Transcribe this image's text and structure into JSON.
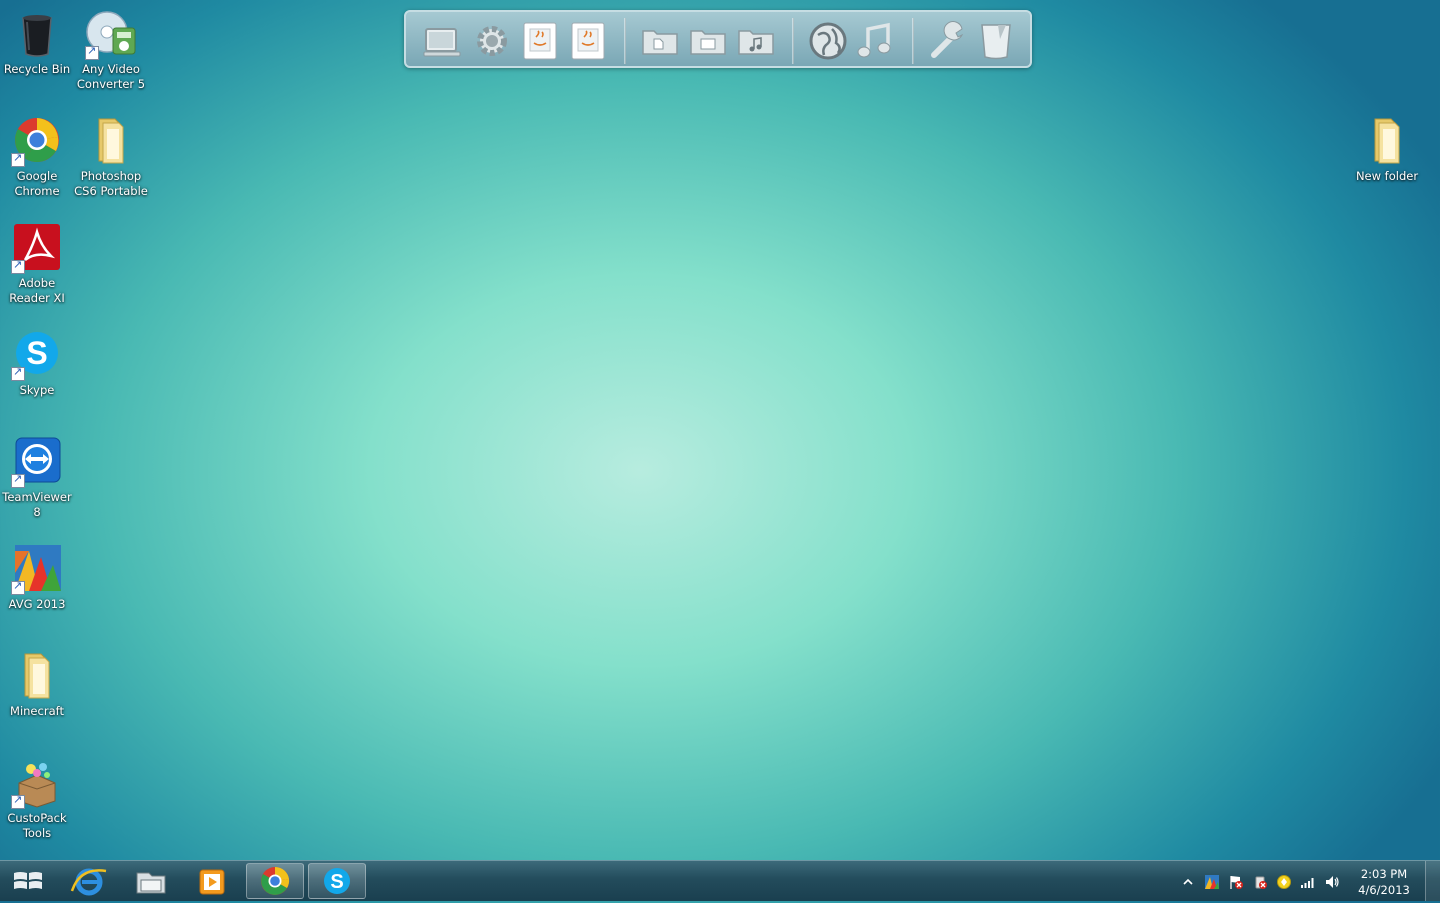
{
  "desktop": {
    "icons": [
      {
        "label": "Recycle Bin",
        "icon": "recycle-bin-icon"
      },
      {
        "label": "Any Video Converter 5",
        "icon": "any-video-converter-icon"
      },
      {
        "label": "Google Chrome",
        "icon": "chrome-icon"
      },
      {
        "label": "Photoshop CS6 Portable",
        "icon": "folder-icon"
      },
      {
        "label": "Adobe Reader XI",
        "icon": "adobe-reader-icon"
      },
      {
        "label": "Skype",
        "icon": "skype-icon"
      },
      {
        "label": "TeamViewer 8",
        "icon": "teamviewer-icon"
      },
      {
        "label": "AVG 2013",
        "icon": "avg-icon"
      },
      {
        "label": "Minecraft",
        "icon": "folder-icon"
      },
      {
        "label": "CustoPack Tools",
        "icon": "custopack-icon"
      },
      {
        "label": "New folder",
        "icon": "folder-icon"
      }
    ]
  },
  "dock": {
    "items": [
      "computer-icon",
      "gear-icon",
      "java-document-icon",
      "java-document-icon",
      "documents-folder-icon",
      "pictures-folder-icon",
      "music-folder-icon",
      "globe-icon",
      "music-note-icon",
      "wrench-icon",
      "trash-icon"
    ]
  },
  "taskbar": {
    "items": [
      "start-button",
      "internet-explorer",
      "file-explorer",
      "media-player",
      "google-chrome",
      "skype"
    ],
    "clock": {
      "time": "2:03 PM",
      "date": "4/6/2013"
    }
  },
  "colors": {
    "accent": "#1f8aa2",
    "taskbar": "#234c5c"
  }
}
